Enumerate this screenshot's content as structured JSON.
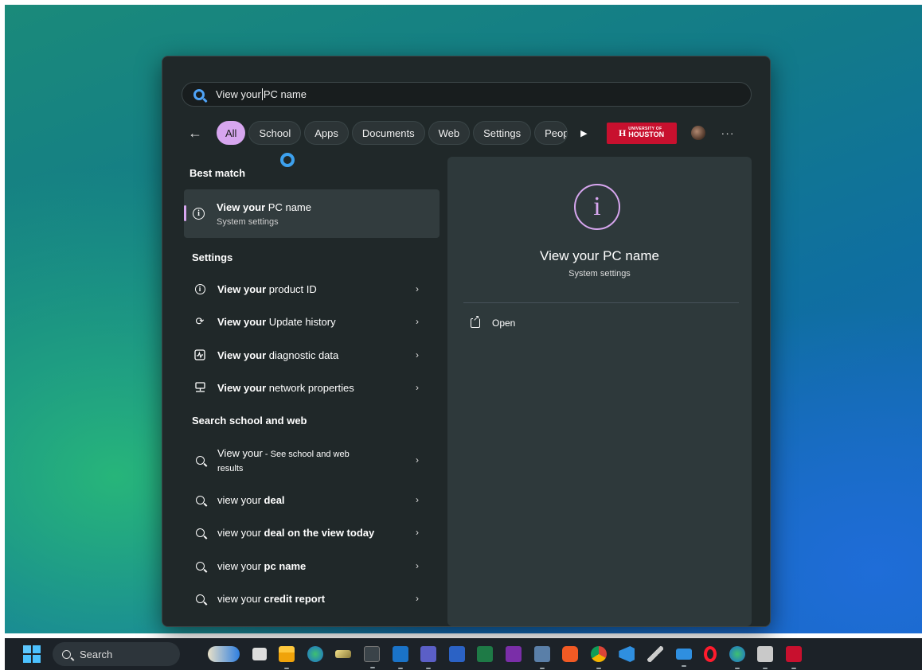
{
  "search": {
    "typed": "View your",
    "suggested": "PC name"
  },
  "filters": {
    "back_icon": "arrow-left-icon",
    "chips": [
      "All",
      "School",
      "Apps",
      "Documents",
      "Web",
      "Settings",
      "Peop"
    ],
    "active": "All",
    "more_icon": "play-icon",
    "org_logo": {
      "mark": "H",
      "small": "UNIVERSITY OF",
      "big": "HOUSTON",
      "color": "#c8102e"
    },
    "overflow": "···"
  },
  "best_match": {
    "section_title": "Best match",
    "title_bold": "View your",
    "title_rest": " PC name",
    "subtitle": "System settings",
    "icon": "info-icon"
  },
  "settings": {
    "section_title": "Settings",
    "items": [
      {
        "icon": "info-icon",
        "bold": "View your",
        "rest": " product ID"
      },
      {
        "icon": "sync-icon",
        "bold": "View your",
        "rest": " Update history"
      },
      {
        "icon": "diagnostic-icon",
        "bold": "View your",
        "rest": " diagnostic data"
      },
      {
        "icon": "network-icon",
        "bold": "View your",
        "rest": " network properties"
      }
    ]
  },
  "web": {
    "section_title": "Search school and web",
    "first": {
      "main": "View your",
      "tail": " - See school and web",
      "line2": "results"
    },
    "items": [
      {
        "plain": "view your ",
        "bold": "deal"
      },
      {
        "plain": "view your ",
        "bold": "deal on the view today"
      },
      {
        "plain": "view your ",
        "bold": "pc name"
      },
      {
        "plain": "view your ",
        "bold": "credit report"
      }
    ]
  },
  "preview": {
    "title": "View your PC name",
    "subtitle": "System settings",
    "action": "Open"
  },
  "taskbar": {
    "search_label": "Search",
    "apps": [
      "copilot-icon",
      "task-view-icon",
      "file-explorer-icon",
      "edge-dev-icon",
      "pencil-app-icon",
      "terminal-icon",
      "outlook-icon",
      "teams-icon",
      "word-icon",
      "excel-icon",
      "onenote-icon",
      "remote-icon",
      "brave-icon",
      "chrome-icon",
      "vscode-icon",
      "pen-icon",
      "remote-desktop-icon",
      "opera-icon",
      "edge-icon",
      "notepad-icon",
      "acrobat-icon"
    ]
  },
  "colors": {
    "accent": "#d7a6ef",
    "panel": "#202829",
    "preview": "#2e393b"
  }
}
